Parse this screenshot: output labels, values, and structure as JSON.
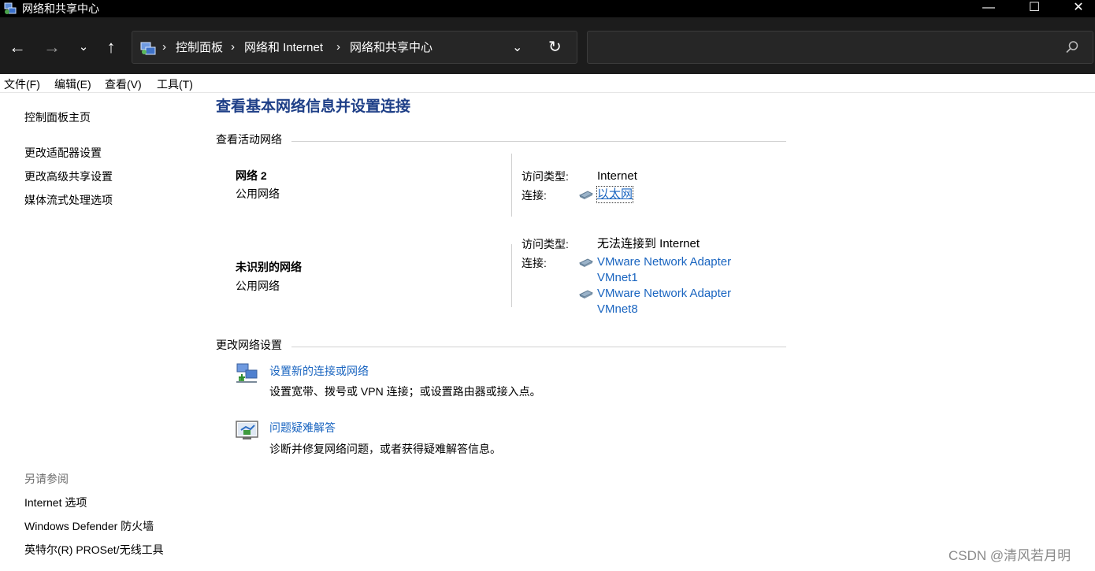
{
  "window": {
    "title": "网络和共享中心",
    "minimize_glyph": "—",
    "maximize_glyph": "☐",
    "close_glyph": "✕"
  },
  "nav": {
    "back_glyph": "←",
    "forward_glyph": "→",
    "recent_glyph": "⌄",
    "up_glyph": "↑",
    "breadcrumb": [
      "控制面板",
      "网络和 Internet",
      "网络和共享中心"
    ],
    "separator": "›",
    "dropdown_glyph": "⌄",
    "refresh_glyph": "↻",
    "search_placeholder": ""
  },
  "menu": [
    "文件(F)",
    "编辑(E)",
    "查看(V)",
    "工具(T)"
  ],
  "left_pane": {
    "home": "控制面板主页",
    "links": [
      "更改适配器设置",
      "更改高级共享设置",
      "媒体流式处理选项"
    ],
    "see_also_heading": "另请参阅",
    "see_also": [
      "Internet 选项",
      "Windows Defender 防火墙",
      "英特尔(R) PROSet/无线工具"
    ]
  },
  "main": {
    "title": "查看基本网络信息并设置连接",
    "active_networks_heading": "查看活动网络",
    "networks": [
      {
        "name": "网络 2",
        "category": "公用网络",
        "access_label": "访问类型:",
        "access_value": "Internet",
        "connection_label": "连接:",
        "connections": [
          "以太网"
        ]
      },
      {
        "name": "未识别的网络",
        "category": "公用网络",
        "access_label": "访问类型:",
        "access_value": "无法连接到 Internet",
        "connection_label": "连接:",
        "connections": [
          "VMware Network Adapter",
          "VMnet1",
          "VMware Network Adapter",
          "VMnet8"
        ]
      }
    ],
    "change_settings_heading": "更改网络设置",
    "tasks": [
      {
        "link": "设置新的连接或网络",
        "description": "设置宽带、拨号或 VPN 连接；或设置路由器或接入点。",
        "icon": "new-connection-icon"
      },
      {
        "link": "问题疑难解答",
        "description": "诊断并修复网络问题，或者获得疑难解答信息。",
        "icon": "troubleshoot-icon"
      }
    ]
  },
  "watermark": "CSDN @清风若月明",
  "colors": {
    "titlebar": "#000000",
    "navbar": "#1c1c1c",
    "link": "#1a65c0",
    "heading": "#1e3f87"
  }
}
